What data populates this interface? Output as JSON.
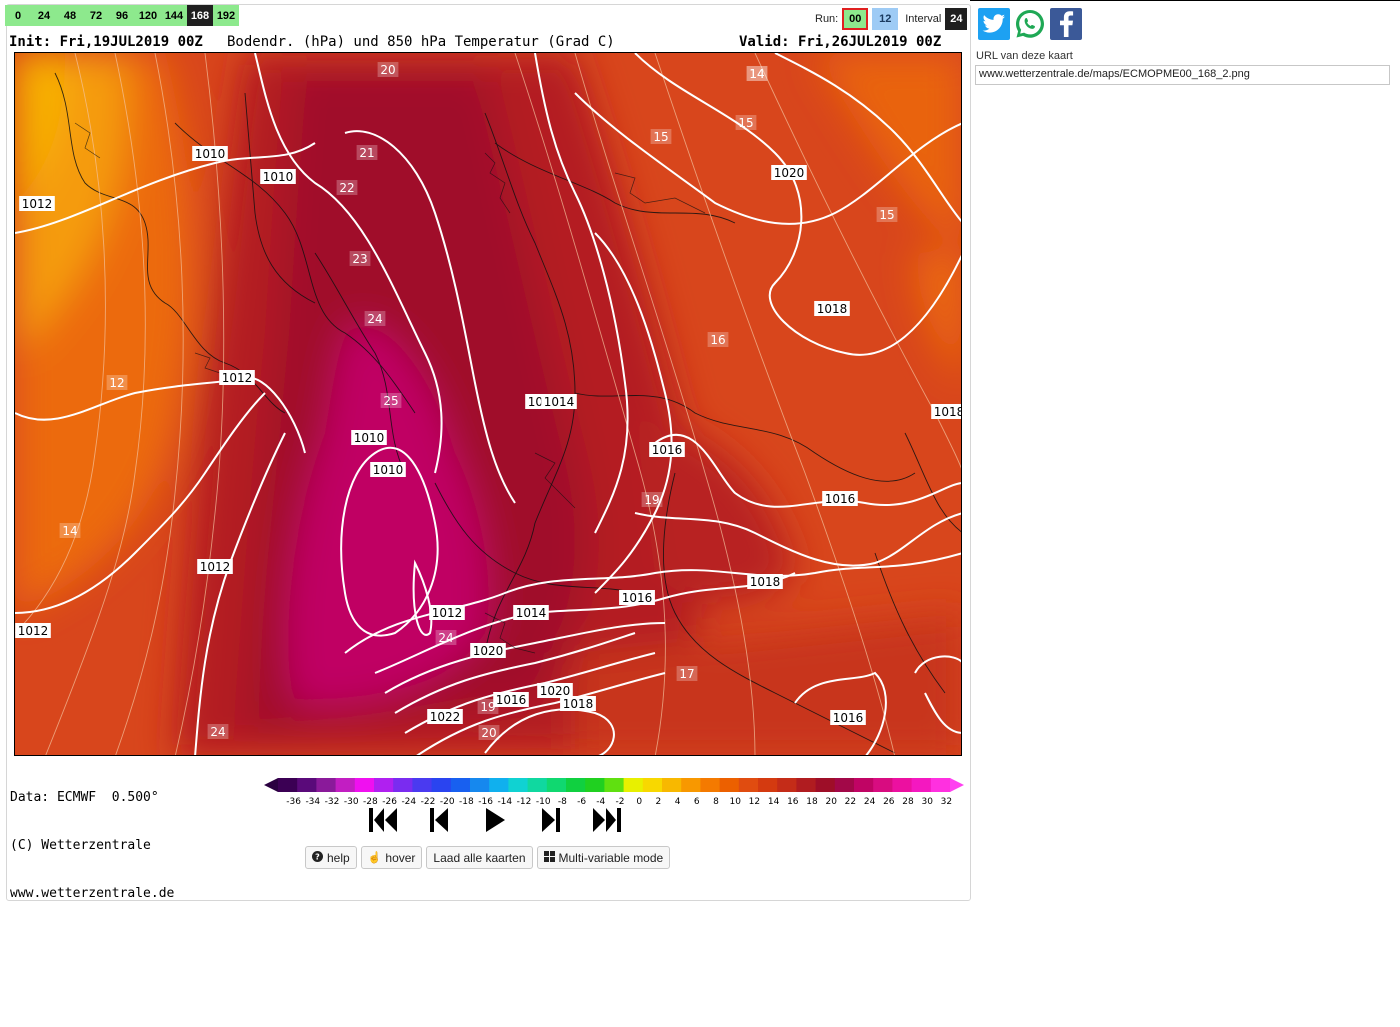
{
  "hours": [
    "0",
    "24",
    "48",
    "72",
    "96",
    "120",
    "144",
    "168",
    "192"
  ],
  "active_hour": "168",
  "run": {
    "label": "Run:",
    "run_a": "00",
    "run_b": "12",
    "interval_label": "Interval",
    "interval_value": "24"
  },
  "title": {
    "init": "Init: Fri,19JUL2019 00Z",
    "param": "Bodendr. (hPa) und 850 hPa Temperatur (Grad C)",
    "valid": "Valid: Fri,26JUL2019 00Z"
  },
  "map": {
    "isobar_labels": [
      "1010",
      "1010",
      "1012",
      "1012",
      "1012",
      "1010",
      "1010",
      "1012",
      "1014",
      "1012",
      "1014",
      "1016",
      "1018",
      "1020",
      "1022",
      "1016",
      "1020",
      "1018",
      "1016",
      "1014",
      "1016",
      "1016",
      "1018",
      "1018",
      "1016",
      "1020",
      "1018"
    ],
    "isotherm_labels": [
      "20",
      "21",
      "22",
      "23",
      "24",
      "25",
      "14",
      "15",
      "15",
      "15",
      "16",
      "19",
      "17",
      "12",
      "14",
      "24",
      "19",
      "20",
      "24",
      "14"
    ]
  },
  "credits": {
    "line1": "Data: ECMWF  0.500°",
    "line2": "(C) Wetterzentrale",
    "line3": "www.wetterzentrale.de"
  },
  "colorbar": {
    "ticks": [
      "-36",
      "-34",
      "-32",
      "-30",
      "-28",
      "-26",
      "-24",
      "-22",
      "-20",
      "-18",
      "-16",
      "-14",
      "-12",
      "-10",
      "-8",
      "-6",
      "-4",
      "-2",
      "0",
      "2",
      "4",
      "6",
      "8",
      "10",
      "12",
      "14",
      "16",
      "18",
      "20",
      "22",
      "24",
      "26",
      "28",
      "30",
      "32"
    ],
    "colors": [
      "#3b0054",
      "#5a0a7a",
      "#8a1a9a",
      "#c21ec2",
      "#f010f0",
      "#b020f0",
      "#7a2cf0",
      "#4a3af0",
      "#2a44f0",
      "#1860f0",
      "#1688ee",
      "#10b0ee",
      "#10d2d2",
      "#10d8a0",
      "#10d870",
      "#10d040",
      "#20d020",
      "#60e010",
      "#e8f000",
      "#f8d800",
      "#f8b800",
      "#f89800",
      "#f47a00",
      "#ec6000",
      "#e04c10",
      "#d43a10",
      "#c42c18",
      "#b01c20",
      "#9e0e28",
      "#a20848",
      "#c00464",
      "#d80c80",
      "#ec10a0",
      "#f418c0",
      "#ff30e0"
    ]
  },
  "playback": {
    "first": "first-frame",
    "prev": "previous-frame",
    "play": "play",
    "next": "next-frame",
    "last": "last-frame"
  },
  "buttons": {
    "help": "help",
    "hover": "hover",
    "load_all": "Laad alle kaarten",
    "multi": "Multi-variable mode"
  },
  "share": {
    "url_label": "URL van deze kaart",
    "url_value": "www.wetterzentrale.de/maps/ECMOPME00_168_2.png"
  }
}
